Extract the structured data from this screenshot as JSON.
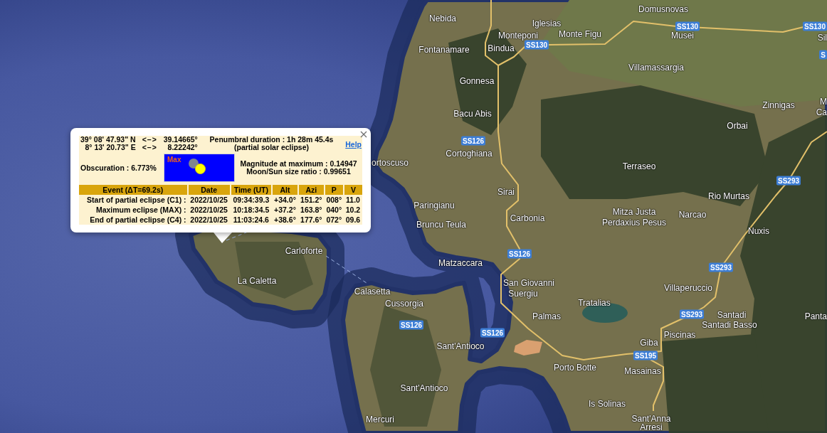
{
  "map": {
    "labels": [
      {
        "kind": "place",
        "text": "Domusnovas"
      },
      {
        "kind": "place",
        "text": "Nebida"
      },
      {
        "kind": "place",
        "text": "Iglesias"
      },
      {
        "kind": "road",
        "text": "SS130"
      },
      {
        "kind": "road",
        "text": "SS130"
      },
      {
        "kind": "place",
        "text": "Monteponi"
      },
      {
        "kind": "place",
        "text": "Monte Figu"
      },
      {
        "kind": "place",
        "text": "Musei"
      },
      {
        "kind": "place",
        "text": "Sil"
      },
      {
        "kind": "road",
        "text": "SS130"
      },
      {
        "kind": "place",
        "text": "Fontanamare"
      },
      {
        "kind": "place",
        "text": "Bindua"
      },
      {
        "kind": "road",
        "text": "S"
      },
      {
        "kind": "place",
        "text": "Villamassargia"
      },
      {
        "kind": "place",
        "text": "Gonnesa"
      },
      {
        "kind": "place",
        "text": "M"
      },
      {
        "kind": "place",
        "text": "Zinnigas"
      },
      {
        "kind": "place",
        "text": "Ca"
      },
      {
        "kind": "place",
        "text": "Bacu Abis"
      },
      {
        "kind": "place",
        "text": "Orbai"
      },
      {
        "kind": "road",
        "text": "SS126"
      },
      {
        "kind": "place",
        "text": "Cortoghiana"
      },
      {
        "kind": "place",
        "text": "ortoscuso"
      },
      {
        "kind": "place",
        "text": "Terraseo"
      },
      {
        "kind": "road",
        "text": "SS293"
      },
      {
        "kind": "place",
        "text": "Sirai"
      },
      {
        "kind": "place",
        "text": "Rio Murtas"
      },
      {
        "kind": "place",
        "text": "Paringianu"
      },
      {
        "kind": "place",
        "text": "Mitza Justa"
      },
      {
        "kind": "place",
        "text": "Narcao"
      },
      {
        "kind": "place",
        "text": "Carbonia"
      },
      {
        "kind": "place",
        "text": "Perdaxius Pesus"
      },
      {
        "kind": "place",
        "text": "Bruncu Teula"
      },
      {
        "kind": "place",
        "text": "Nuxis"
      },
      {
        "kind": "place",
        "text": "Carloforte"
      },
      {
        "kind": "road",
        "text": "SS126"
      },
      {
        "kind": "place",
        "text": "Matzaccara"
      },
      {
        "kind": "road",
        "text": "SS293"
      },
      {
        "kind": "place",
        "text": "La Caletta"
      },
      {
        "kind": "place",
        "text": "San Giovanni"
      },
      {
        "kind": "place",
        "text": "Villaperuccio"
      },
      {
        "kind": "place",
        "text": "Calasetta"
      },
      {
        "kind": "place",
        "text": "Suergiu"
      },
      {
        "kind": "place",
        "text": "Tratalias"
      },
      {
        "kind": "place",
        "text": "Cussorgia"
      },
      {
        "kind": "place",
        "text": "Palmas"
      },
      {
        "kind": "road",
        "text": "SS293"
      },
      {
        "kind": "place",
        "text": "Santadi"
      },
      {
        "kind": "place",
        "text": "Panta"
      },
      {
        "kind": "road",
        "text": "SS126"
      },
      {
        "kind": "place",
        "text": "Santadi Basso"
      },
      {
        "kind": "road",
        "text": "SS126"
      },
      {
        "kind": "place",
        "text": "Piscinas"
      },
      {
        "kind": "place",
        "text": "Giba"
      },
      {
        "kind": "place",
        "text": "Sant'Antioco"
      },
      {
        "kind": "road",
        "text": "SS195"
      },
      {
        "kind": "place",
        "text": "Porto Botte"
      },
      {
        "kind": "place",
        "text": "Masainas"
      },
      {
        "kind": "place",
        "text": "Sant'Antioco"
      },
      {
        "kind": "place",
        "text": "Is Solinas"
      },
      {
        "kind": "place",
        "text": "Mercuri"
      },
      {
        "kind": "place",
        "text": "Sant'Anna"
      },
      {
        "kind": "place",
        "text": "Arresi"
      }
    ]
  },
  "popup": {
    "coordinates": [
      {
        "dms": "39° 08' 47.93\" N",
        "separator": "<–>",
        "decimal": "39.14665°"
      },
      {
        "dms": "8° 13' 20.73\" E",
        "separator": "<–>",
        "decimal": "8.22242°"
      }
    ],
    "duration": "Penumbral duration : 1h 28m 45.4s",
    "eclipse_type": "(partial solar eclipse)",
    "help_link": "Help",
    "obscuration": "Obscuration : 6.773%",
    "diagram": {
      "label": "Max"
    },
    "magnitude": "Magnitude at maximum : 0.14947",
    "size_ratio": "Moon/Sun size ratio : 0.99651",
    "table": {
      "columns": [
        "Event (ΔT=69.2s)",
        "Date",
        "Time (UT)",
        "Alt",
        "Azi",
        "P",
        "V"
      ],
      "rows": [
        [
          "Start of partial eclipse (C1) :",
          "2022/10/25",
          "09:34:39.3",
          "+34.0°",
          "151.2°",
          "008°",
          "11.0"
        ],
        [
          "Maximum eclipse (MAX) :",
          "2022/10/25",
          "10:18:34.5",
          "+37.2°",
          "163.8°",
          "040°",
          "10.2"
        ],
        [
          "End of partial eclipse (C4) :",
          "2022/10/25",
          "11:03:24.6",
          "+38.6°",
          "177.6°",
          "072°",
          "09.6"
        ]
      ]
    }
  }
}
